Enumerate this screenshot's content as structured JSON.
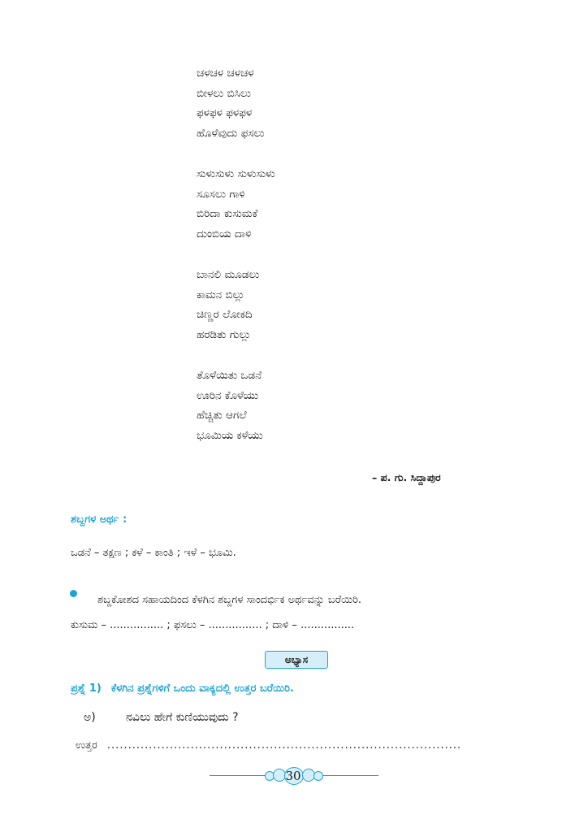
{
  "poem": {
    "stanzas": [
      [
        "ಚಳಚಳ ಚಳಚಳ",
        "ಬೀಳಲು ಬಿಸಿಲು",
        "ಫಳಫಳ ಫಳಫಳ",
        "ಹೊಳೆವುದು ಫಸಲು"
      ],
      [
        "ಸುಳುಸುಳು ಸುಳುಸುಳು",
        "ಸೂಸಲು ಗಾಳಿ",
        "ಬಿರಿದಾ ಕುಸುಮಕೆ",
        "ದುಂಬಿಯ ದಾಳಿ"
      ],
      [
        "ಬಾನಲಿ ಮೂಡಲು",
        "ಕಾಮನ ಬಿಲ್ಲು",
        "ಚಿಣ್ಣರ ಲೋಕದಿ",
        "ಹರಡಿತು ಗುಲ್ಲು"
      ],
      [
        "ತೊಳೆಯಿತು ಒಡನೆ",
        "ಊರಿನ ಕೊಳೆಯು",
        "ಹೆಚ್ಚಿತು ಆಗಲೆ",
        "ಭೂಮಿಯ ಕಳೆಯು"
      ]
    ],
    "author": "– ಪ. ಗು. ಸಿದ್ದಾಪುರ"
  },
  "word_meanings": {
    "heading": "ಶಬ್ದಗಳ ಅರ್ಥ :",
    "text": "ಒಡನೆ – ತಕ್ಷಣ ;  ಕಳೆ –  ಕಾಂತಿ ;  ಇಳೆ – ಭೂಮಿ."
  },
  "exercise": {
    "instruction": "ಶಬ್ದಕೋಶದ ಸಹಾಯದಿಂದ ಕೆಳಗಿನ ಶಬ್ದಗಳ ಸಾಂದರ್ಭಿಕ ಅರ್ಥವನ್ನು ಬರೆಯಿರಿ.",
    "blanks": "ಕುಸುಮ – ................ ;      ಫಸಲು – ................ ;      ದಾಳಿ – ................"
  },
  "practice": {
    "badge": "ಅಭ್ಯಾಸ",
    "question_number": "ಪ್ರಶ್ನೆ 1)",
    "question_text": "ಕೆಳಗಿನ ಪ್ರಶ್ನೆಗಳಿಗೆ ಒಂದು ವಾಕ್ಯದಲ್ಲಿ ಉತ್ತರ ಬರೆಯಿರಿ.",
    "sub_label": "ಅ)",
    "sub_question": "ನವಿಲು ಹೇಗೆ ಕುಣಿಯುವುದು ?",
    "answer_label": "ಉತ್ತರ",
    "answer_dots": "....................................................................................."
  },
  "page_number": "30",
  "colors": {
    "accent": "#1ba3d6",
    "badge_fill": "#d6eef8"
  }
}
